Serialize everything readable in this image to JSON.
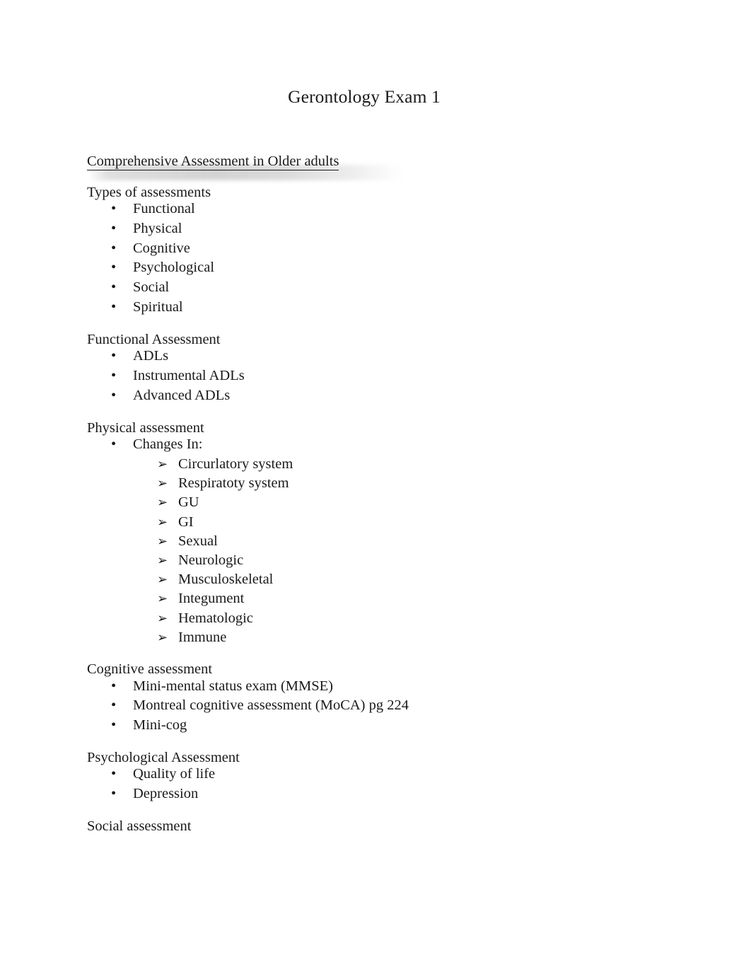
{
  "document": {
    "title": "Gerontology Exam 1"
  },
  "bullets": {
    "level1_glyph": "•",
    "level2_glyph": "➢"
  },
  "sections": [
    {
      "heading": "Comprehensive Assessment in Older adults",
      "underlined": true,
      "highlighted": true
    },
    {
      "heading": "Types of assessments",
      "items": [
        "Functional",
        "Physical",
        "Cognitive",
        "Psychological",
        "Social",
        "Spiritual"
      ]
    },
    {
      "heading": "Functional Assessment",
      "items": [
        "ADLs",
        "Instrumental ADLs",
        "Advanced ADLs"
      ]
    },
    {
      "heading": "Physical assessment",
      "items": [
        "Changes In:"
      ],
      "subitems": [
        "Circurlatory system",
        "Respiratoty system",
        "GU",
        "GI",
        "Sexual",
        "Neurologic",
        "Musculoskeletal",
        "Integument",
        "Hematologic",
        "Immune"
      ]
    },
    {
      "heading": "Cognitive assessment",
      "items": [
        "Mini-mental status exam (MMSE)",
        "Montreal cognitive assessment (MoCA) pg 224",
        "Mini-cog"
      ]
    },
    {
      "heading": "Psychological Assessment",
      "items": [
        "Quality of life",
        "Depression"
      ]
    },
    {
      "heading": "Social assessment",
      "items": []
    }
  ]
}
